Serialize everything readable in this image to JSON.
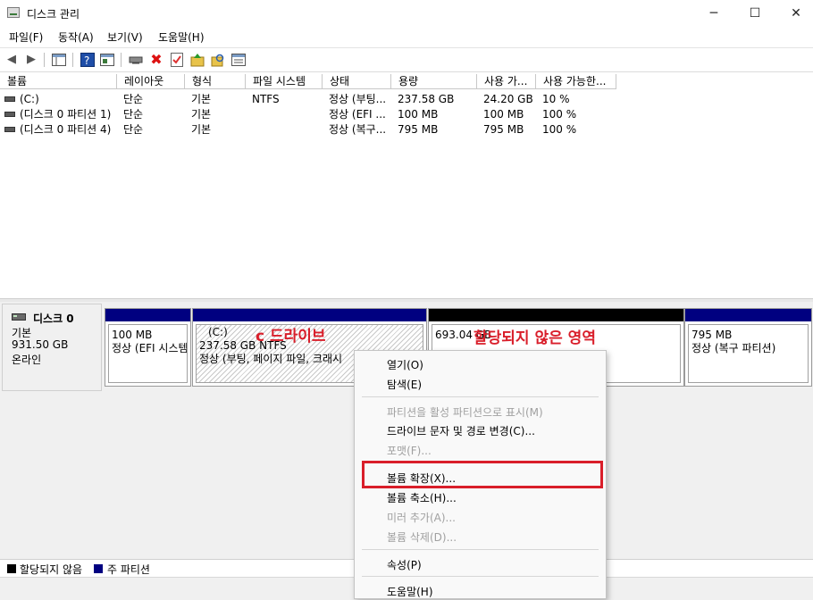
{
  "window": {
    "title": "디스크 관리",
    "min": "─",
    "max": "☐",
    "close": "✕"
  },
  "menu": [
    "파일(F)",
    "동작(A)",
    "보기(V)",
    "도움말(H)"
  ],
  "volume_table": {
    "headers": [
      "볼륨",
      "레이아웃",
      "형식",
      "파일 시스템",
      "상태",
      "용량",
      "사용 가...",
      "사용 가능한..."
    ],
    "rows": [
      [
        "(C:)",
        "단순",
        "기본",
        "NTFS",
        "정상 (부팅...",
        "237.58 GB",
        "24.20 GB",
        "10 %"
      ],
      [
        "(디스크 0 파티션 1)",
        "단순",
        "기본",
        "",
        "정상 (EFI ...",
        "100 MB",
        "100 MB",
        "100 %"
      ],
      [
        "(디스크 0 파티션 4)",
        "단순",
        "기본",
        "",
        "정상 (복구...",
        "795 MB",
        "795 MB",
        "100 %"
      ]
    ]
  },
  "disk": {
    "name": "디스크 0",
    "type": "기본",
    "size": "931.50 GB",
    "status": "온라인"
  },
  "partitions": [
    {
      "size": "100 MB",
      "desc": "정상 (EFI 시스템"
    },
    {
      "label": "(C:)",
      "size": "237.58 GB NTFS",
      "desc": "정상 (부팅, 페이지 파일, 크래시"
    },
    {
      "size": "693.04 GB",
      "desc": ""
    },
    {
      "size": "795 MB",
      "desc": "정상 (복구 파티션)"
    }
  ],
  "annotations": {
    "c_drive": "c 드라이브",
    "unallocated": "할당되지 않은 영역"
  },
  "legend": {
    "unallocated": "할당되지 않음",
    "primary": "주 파티션"
  },
  "context_menu": {
    "items": [
      {
        "label": "열기(O)",
        "enabled": true
      },
      {
        "label": "탐색(E)",
        "enabled": true
      },
      {
        "label": "파티션을 활성 파티션으로 표시(M)",
        "enabled": false
      },
      {
        "label": "드라이브 문자 및 경로 변경(C)...",
        "enabled": true
      },
      {
        "label": "포맷(F)...",
        "enabled": false
      },
      {
        "label": "볼륨 확장(X)...",
        "enabled": true
      },
      {
        "label": "볼륨 축소(H)...",
        "enabled": true
      },
      {
        "label": "미러 추가(A)...",
        "enabled": false
      },
      {
        "label": "볼륨 삭제(D)...",
        "enabled": false
      },
      {
        "label": "속성(P)",
        "enabled": true
      },
      {
        "label": "도움말(H)",
        "enabled": true
      }
    ]
  },
  "colors": {
    "primary_partition": "#000080",
    "unallocated": "#000000",
    "highlight": "#d91e2a"
  }
}
